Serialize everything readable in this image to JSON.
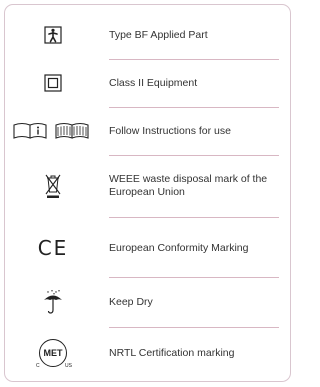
{
  "symbols": [
    {
      "icon": "type-bf-applied-part-icon",
      "label": "Type BF Applied Part"
    },
    {
      "icon": "class-ii-equipment-icon",
      "label": "Class II Equipment"
    },
    {
      "icon": "follow-instructions-icon",
      "label": "Follow Instructions for use"
    },
    {
      "icon": "weee-disposal-icon",
      "label": "WEEE waste disposal mark of the European Union"
    },
    {
      "icon": "ce-mark-icon",
      "label": "European Conformity Marking",
      "glyph": "CE"
    },
    {
      "icon": "keep-dry-icon",
      "label": "Keep Dry"
    },
    {
      "icon": "met-certification-icon",
      "label": "NRTL Certification marking",
      "glyph": "MET",
      "sub_left": "C",
      "sub_right": "US"
    }
  ],
  "colors": {
    "border": "#d9c6cf",
    "divider": "#d8b7c3",
    "text": "#333333",
    "icon": "#222222"
  }
}
